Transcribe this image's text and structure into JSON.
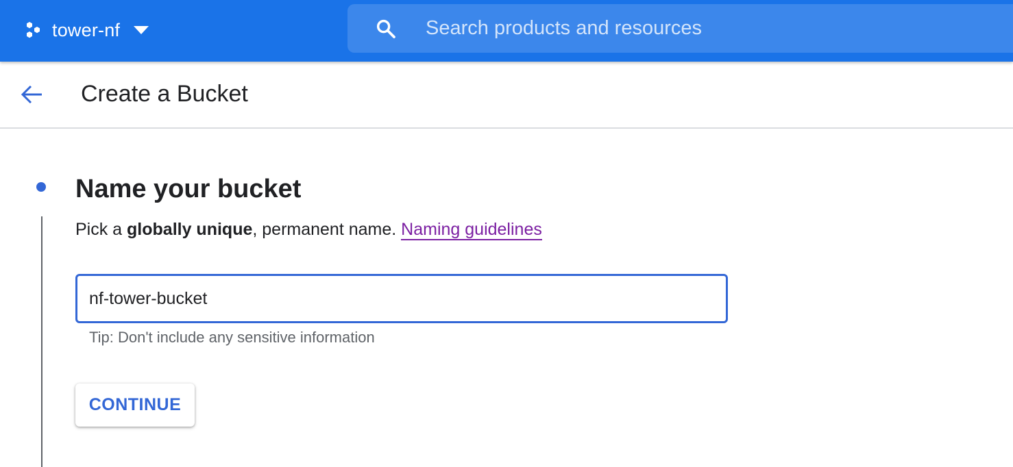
{
  "topbar": {
    "background_color": "#1a73e8",
    "project_icon": "project-hexagon-icon",
    "project_name": "tower-nf",
    "project_dropdown_icon": "caret-down-icon",
    "search": {
      "icon": "search-icon",
      "placeholder": "Search products and resources"
    }
  },
  "subheader": {
    "back_icon": "arrow-back-icon",
    "title": "Create a Bucket"
  },
  "step": {
    "title": "Name your bucket",
    "description_prefix": "Pick a ",
    "description_bold": "globally unique",
    "description_suffix": ", permanent name. ",
    "link_text": "Naming guidelines",
    "link_color": "#7b1fa2",
    "accent_color": "#3367d6",
    "name_field": {
      "value": "nf-tower-bucket"
    },
    "tip": "Tip: Don't include any sensitive information",
    "continue_label": "CONTINUE"
  }
}
